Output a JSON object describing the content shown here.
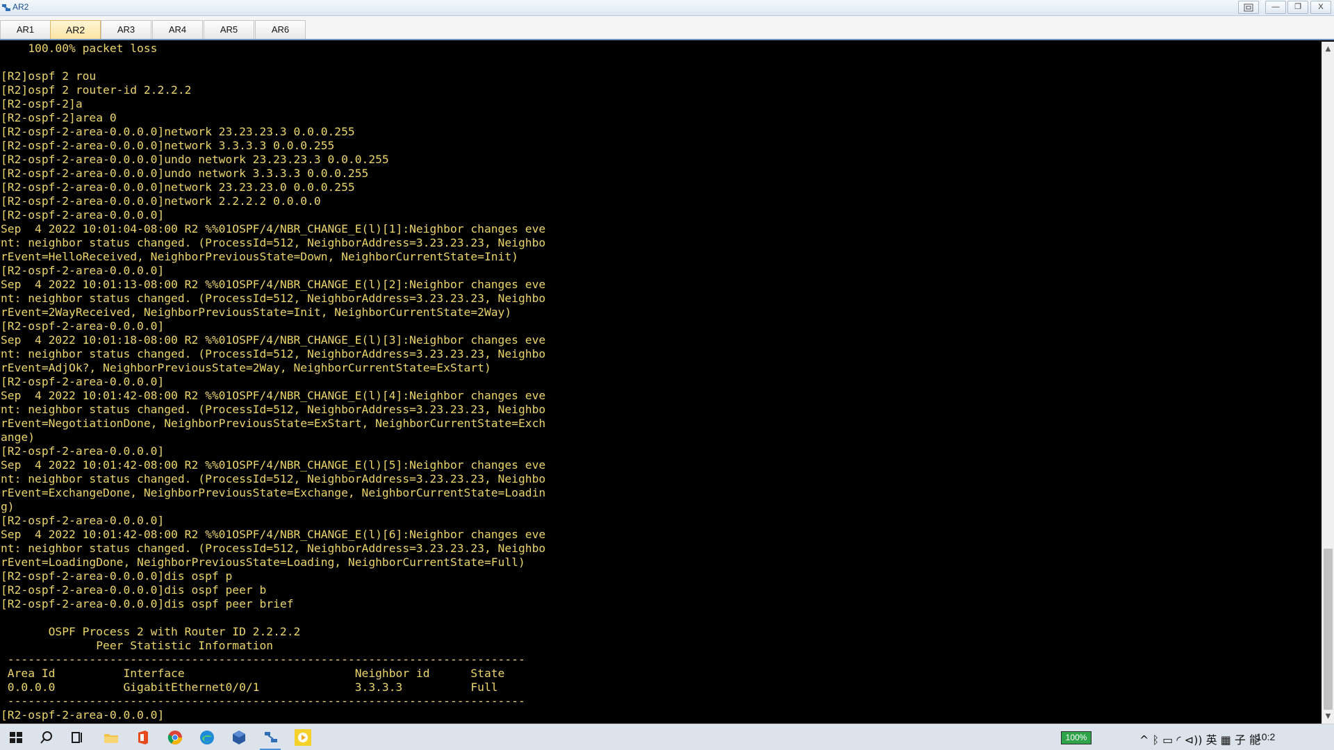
{
  "window": {
    "title": "AR2",
    "minimize_label": "—",
    "restore_label": "❐",
    "close_label": "X"
  },
  "tabs": [
    {
      "label": "AR1",
      "active": false
    },
    {
      "label": "AR2",
      "active": true
    },
    {
      "label": "AR3",
      "active": false
    },
    {
      "label": "AR4",
      "active": false
    },
    {
      "label": "AR5",
      "active": false
    },
    {
      "label": "AR6",
      "active": false
    }
  ],
  "terminal": {
    "text_color": "#ecd56a",
    "background": "#000000",
    "lines": [
      "    100.00% packet loss",
      "",
      "[R2]ospf 2 rou",
      "[R2]ospf 2 router-id 2.2.2.2",
      "[R2-ospf-2]a",
      "[R2-ospf-2]area 0",
      "[R2-ospf-2-area-0.0.0.0]network 23.23.23.3 0.0.0.255",
      "[R2-ospf-2-area-0.0.0.0]network 3.3.3.3 0.0.0.255",
      "[R2-ospf-2-area-0.0.0.0]undo network 23.23.23.3 0.0.0.255",
      "[R2-ospf-2-area-0.0.0.0]undo network 3.3.3.3 0.0.0.255",
      "[R2-ospf-2-area-0.0.0.0]network 23.23.23.0 0.0.0.255",
      "[R2-ospf-2-area-0.0.0.0]network 2.2.2.2 0.0.0.0",
      "[R2-ospf-2-area-0.0.0.0]",
      "Sep  4 2022 10:01:04-08:00 R2 %%01OSPF/4/NBR_CHANGE_E(l)[1]:Neighbor changes eve",
      "nt: neighbor status changed. (ProcessId=512, NeighborAddress=3.23.23.23, Neighbo",
      "rEvent=HelloReceived, NeighborPreviousState=Down, NeighborCurrentState=Init)",
      "[R2-ospf-2-area-0.0.0.0]",
      "Sep  4 2022 10:01:13-08:00 R2 %%01OSPF/4/NBR_CHANGE_E(l)[2]:Neighbor changes eve",
      "nt: neighbor status changed. (ProcessId=512, NeighborAddress=3.23.23.23, Neighbo",
      "rEvent=2WayReceived, NeighborPreviousState=Init, NeighborCurrentState=2Way)",
      "[R2-ospf-2-area-0.0.0.0]",
      "Sep  4 2022 10:01:18-08:00 R2 %%01OSPF/4/NBR_CHANGE_E(l)[3]:Neighbor changes eve",
      "nt: neighbor status changed. (ProcessId=512, NeighborAddress=3.23.23.23, Neighbo",
      "rEvent=AdjOk?, NeighborPreviousState=2Way, NeighborCurrentState=ExStart)",
      "[R2-ospf-2-area-0.0.0.0]",
      "Sep  4 2022 10:01:42-08:00 R2 %%01OSPF/4/NBR_CHANGE_E(l)[4]:Neighbor changes eve",
      "nt: neighbor status changed. (ProcessId=512, NeighborAddress=3.23.23.23, Neighbo",
      "rEvent=NegotiationDone, NeighborPreviousState=ExStart, NeighborCurrentState=Exch",
      "ange)",
      "[R2-ospf-2-area-0.0.0.0]",
      "Sep  4 2022 10:01:42-08:00 R2 %%01OSPF/4/NBR_CHANGE_E(l)[5]:Neighbor changes eve",
      "nt: neighbor status changed. (ProcessId=512, NeighborAddress=3.23.23.23, Neighbo",
      "rEvent=ExchangeDone, NeighborPreviousState=Exchange, NeighborCurrentState=Loadin",
      "g)",
      "[R2-ospf-2-area-0.0.0.0]",
      "Sep  4 2022 10:01:42-08:00 R2 %%01OSPF/4/NBR_CHANGE_E(l)[6]:Neighbor changes eve",
      "nt: neighbor status changed. (ProcessId=512, NeighborAddress=3.23.23.23, Neighbo",
      "rEvent=LoadingDone, NeighborPreviousState=Loading, NeighborCurrentState=Full)",
      "[R2-ospf-2-area-0.0.0.0]dis ospf p",
      "[R2-ospf-2-area-0.0.0.0]dis ospf peer b",
      "[R2-ospf-2-area-0.0.0.0]dis ospf peer brief",
      "",
      "       OSPF Process 2 with Router ID 2.2.2.2",
      "              Peer Statistic Information",
      " ----------------------------------------------------------------------------",
      " Area Id          Interface                         Neighbor id      State",
      " 0.0.0.0          GigabitEthernet0/0/1              3.3.3.3          Full",
      " ----------------------------------------------------------------------------",
      "[R2-ospf-2-area-0.0.0.0]"
    ]
  },
  "scrollbar": {
    "up_label": "▲",
    "down_label": "▼"
  },
  "taskbar": {
    "icons": [
      "windows-start-icon",
      "search-icon",
      "task-view-icon",
      "file-explorer-icon",
      "office-icon",
      "chrome-icon",
      "edge-icon",
      "virtualbox-icon",
      "ensp-icon",
      "media-player-icon"
    ],
    "battery_label": "100%",
    "tray_text": "^ ᛒ ▭ ◜ ⊲)) 英 ▦ 子 能",
    "clock": "10:2"
  }
}
